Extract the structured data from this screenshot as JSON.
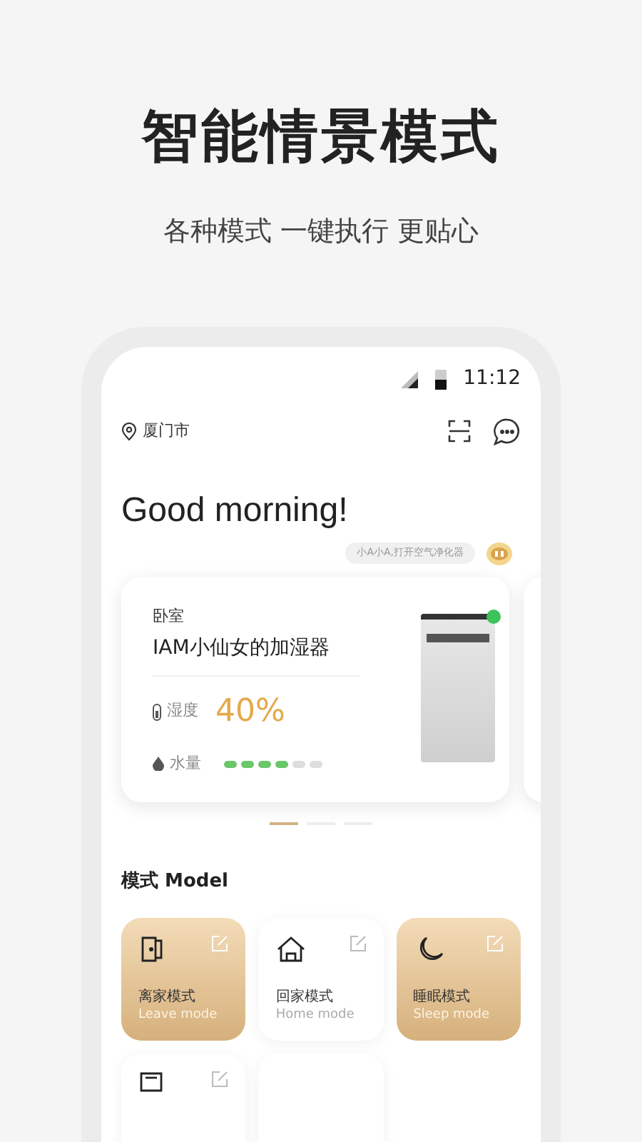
{
  "headline": "智能情景模式",
  "tagline": "各种模式 一键执行 更贴心",
  "status_bar": {
    "time": "11:12"
  },
  "location": "厦门市",
  "greeting": "Good morning!",
  "voice_hint": "小A小A,打开空气净化器",
  "device_card": {
    "room": "卧室",
    "name": "IAM小仙女的加湿器",
    "humidity_label": "湿度",
    "humidity": "40%",
    "water": {
      "label": "水量",
      "level": 0.67
    },
    "online": true
  },
  "carousel_dots": [
    {
      "selected": true
    },
    {
      "selected": false
    },
    {
      "selected": false
    }
  ],
  "modes_title": "模式 Model",
  "modes": [
    {
      "kind": "door",
      "name": "离家模式",
      "english": "Leave mode",
      "active": true
    },
    {
      "kind": "home",
      "name": "回家模式",
      "english": "Home mode",
      "active": false
    },
    {
      "kind": "moon",
      "name": "睡眠模式",
      "english": "Sleep mode",
      "active": true
    },
    {
      "kind": "screen",
      "active": false
    },
    {
      "kind": "blank",
      "active": false
    }
  ]
}
